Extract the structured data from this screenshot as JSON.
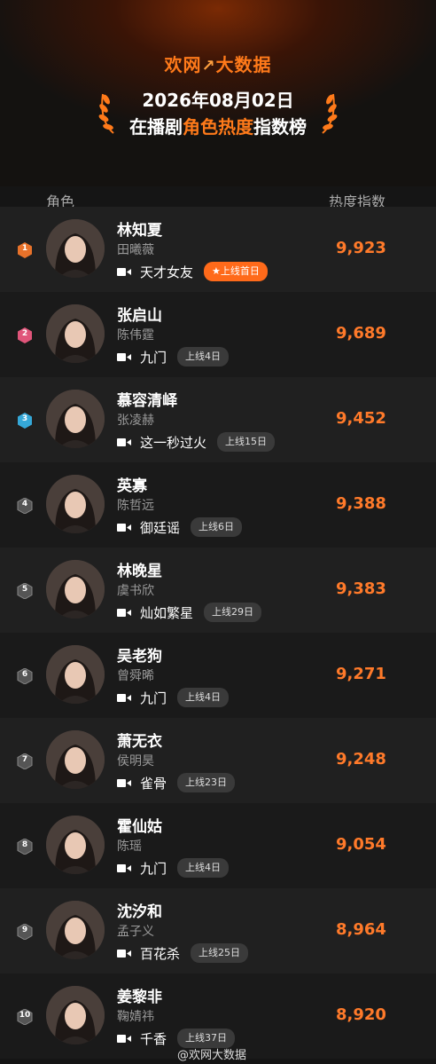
{
  "header": {
    "brand_part1": "欢网",
    "brand_part2": "大数据",
    "date": "2026年08月02日",
    "subtitle_a": "在播剧",
    "subtitle_b": "角色热度",
    "subtitle_c": "指数榜",
    "accent": "#ff7a1a"
  },
  "columns": {
    "role": "角色",
    "index": "热度指数"
  },
  "rows": [
    {
      "rank": "1",
      "name": "林知夏",
      "actor": "田曦薇",
      "show": "天才女友",
      "badge": "上线首日",
      "score": "9,923"
    },
    {
      "rank": "2",
      "name": "张启山",
      "actor": "陈伟霆",
      "show": "九门",
      "badge": "上线4日",
      "score": "9,689"
    },
    {
      "rank": "3",
      "name": "慕容清峄",
      "actor": "张凌赫",
      "show": "这一秒过火",
      "badge": "上线15日",
      "score": "9,452"
    },
    {
      "rank": "4",
      "name": "英寡",
      "actor": "陈哲远",
      "show": "御廷谣",
      "badge": "上线6日",
      "score": "9,388"
    },
    {
      "rank": "5",
      "name": "林晚星",
      "actor": "虞书欣",
      "show": "灿如繁星",
      "badge": "上线29日",
      "score": "9,383"
    },
    {
      "rank": "6",
      "name": "吴老狗",
      "actor": "曾舜晞",
      "show": "九门",
      "badge": "上线4日",
      "score": "9,271"
    },
    {
      "rank": "7",
      "name": "萧无衣",
      "actor": "侯明昊",
      "show": "雀骨",
      "badge": "上线23日",
      "score": "9,248"
    },
    {
      "rank": "8",
      "name": "霍仙姑",
      "actor": "陈瑶",
      "show": "九门",
      "badge": "上线4日",
      "score": "9,054"
    },
    {
      "rank": "9",
      "name": "沈汐和",
      "actor": "孟子义",
      "show": "百花杀",
      "badge": "上线25日",
      "score": "8,964"
    },
    {
      "rank": "10",
      "name": "姜黎非",
      "actor": "鞠婧祎",
      "show": "千香",
      "badge": "上线37日",
      "score": "8,920"
    }
  ],
  "rank_colors": [
    "#e8722a",
    "#e0557a",
    "#35a8d8",
    "#555555",
    "#555555",
    "#555555",
    "#555555",
    "#555555",
    "#555555",
    "#555555"
  ],
  "watermark": "@欢网大数据"
}
